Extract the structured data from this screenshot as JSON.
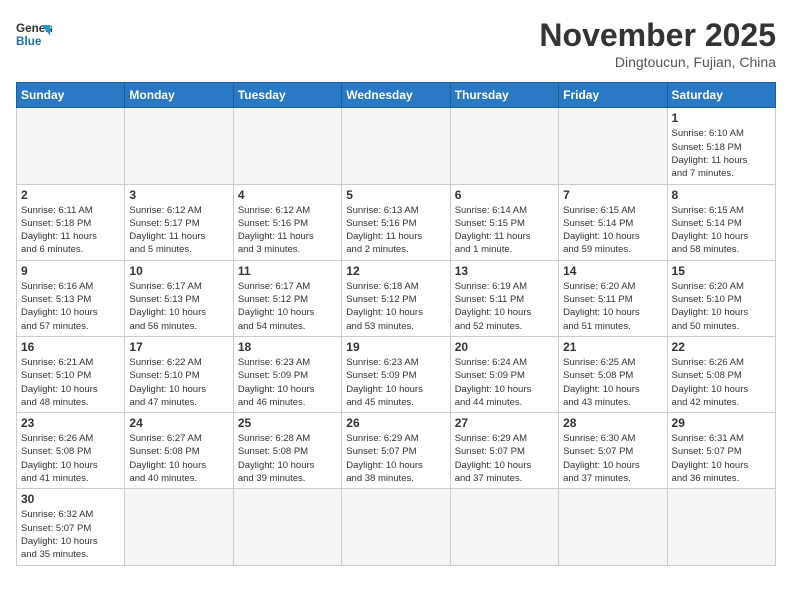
{
  "header": {
    "logo_line1": "General",
    "logo_line2": "Blue",
    "month_title": "November 2025",
    "location": "Dingtoucun, Fujian, China"
  },
  "weekdays": [
    "Sunday",
    "Monday",
    "Tuesday",
    "Wednesday",
    "Thursday",
    "Friday",
    "Saturday"
  ],
  "weeks": [
    [
      {
        "day": "",
        "empty": true
      },
      {
        "day": "",
        "empty": true
      },
      {
        "day": "",
        "empty": true
      },
      {
        "day": "",
        "empty": true
      },
      {
        "day": "",
        "empty": true
      },
      {
        "day": "",
        "empty": true
      },
      {
        "day": "1",
        "info": "Sunrise: 6:10 AM\nSunset: 5:18 PM\nDaylight: 11 hours\nand 7 minutes."
      }
    ],
    [
      {
        "day": "2",
        "info": "Sunrise: 6:11 AM\nSunset: 5:18 PM\nDaylight: 11 hours\nand 6 minutes."
      },
      {
        "day": "3",
        "info": "Sunrise: 6:12 AM\nSunset: 5:17 PM\nDaylight: 11 hours\nand 5 minutes."
      },
      {
        "day": "4",
        "info": "Sunrise: 6:12 AM\nSunset: 5:16 PM\nDaylight: 11 hours\nand 3 minutes."
      },
      {
        "day": "5",
        "info": "Sunrise: 6:13 AM\nSunset: 5:16 PM\nDaylight: 11 hours\nand 2 minutes."
      },
      {
        "day": "6",
        "info": "Sunrise: 6:14 AM\nSunset: 5:15 PM\nDaylight: 11 hours\nand 1 minute."
      },
      {
        "day": "7",
        "info": "Sunrise: 6:15 AM\nSunset: 5:14 PM\nDaylight: 10 hours\nand 59 minutes."
      },
      {
        "day": "8",
        "info": "Sunrise: 6:15 AM\nSunset: 5:14 PM\nDaylight: 10 hours\nand 58 minutes."
      }
    ],
    [
      {
        "day": "9",
        "info": "Sunrise: 6:16 AM\nSunset: 5:13 PM\nDaylight: 10 hours\nand 57 minutes."
      },
      {
        "day": "10",
        "info": "Sunrise: 6:17 AM\nSunset: 5:13 PM\nDaylight: 10 hours\nand 56 minutes."
      },
      {
        "day": "11",
        "info": "Sunrise: 6:17 AM\nSunset: 5:12 PM\nDaylight: 10 hours\nand 54 minutes."
      },
      {
        "day": "12",
        "info": "Sunrise: 6:18 AM\nSunset: 5:12 PM\nDaylight: 10 hours\nand 53 minutes."
      },
      {
        "day": "13",
        "info": "Sunrise: 6:19 AM\nSunset: 5:11 PM\nDaylight: 10 hours\nand 52 minutes."
      },
      {
        "day": "14",
        "info": "Sunrise: 6:20 AM\nSunset: 5:11 PM\nDaylight: 10 hours\nand 51 minutes."
      },
      {
        "day": "15",
        "info": "Sunrise: 6:20 AM\nSunset: 5:10 PM\nDaylight: 10 hours\nand 50 minutes."
      }
    ],
    [
      {
        "day": "16",
        "info": "Sunrise: 6:21 AM\nSunset: 5:10 PM\nDaylight: 10 hours\nand 48 minutes."
      },
      {
        "day": "17",
        "info": "Sunrise: 6:22 AM\nSunset: 5:10 PM\nDaylight: 10 hours\nand 47 minutes."
      },
      {
        "day": "18",
        "info": "Sunrise: 6:23 AM\nSunset: 5:09 PM\nDaylight: 10 hours\nand 46 minutes."
      },
      {
        "day": "19",
        "info": "Sunrise: 6:23 AM\nSunset: 5:09 PM\nDaylight: 10 hours\nand 45 minutes."
      },
      {
        "day": "20",
        "info": "Sunrise: 6:24 AM\nSunset: 5:09 PM\nDaylight: 10 hours\nand 44 minutes."
      },
      {
        "day": "21",
        "info": "Sunrise: 6:25 AM\nSunset: 5:08 PM\nDaylight: 10 hours\nand 43 minutes."
      },
      {
        "day": "22",
        "info": "Sunrise: 6:26 AM\nSunset: 5:08 PM\nDaylight: 10 hours\nand 42 minutes."
      }
    ],
    [
      {
        "day": "23",
        "info": "Sunrise: 6:26 AM\nSunset: 5:08 PM\nDaylight: 10 hours\nand 41 minutes."
      },
      {
        "day": "24",
        "info": "Sunrise: 6:27 AM\nSunset: 5:08 PM\nDaylight: 10 hours\nand 40 minutes."
      },
      {
        "day": "25",
        "info": "Sunrise: 6:28 AM\nSunset: 5:08 PM\nDaylight: 10 hours\nand 39 minutes."
      },
      {
        "day": "26",
        "info": "Sunrise: 6:29 AM\nSunset: 5:07 PM\nDaylight: 10 hours\nand 38 minutes."
      },
      {
        "day": "27",
        "info": "Sunrise: 6:29 AM\nSunset: 5:07 PM\nDaylight: 10 hours\nand 37 minutes."
      },
      {
        "day": "28",
        "info": "Sunrise: 6:30 AM\nSunset: 5:07 PM\nDaylight: 10 hours\nand 37 minutes."
      },
      {
        "day": "29",
        "info": "Sunrise: 6:31 AM\nSunset: 5:07 PM\nDaylight: 10 hours\nand 36 minutes."
      }
    ],
    [
      {
        "day": "30",
        "info": "Sunrise: 6:32 AM\nSunset: 5:07 PM\nDaylight: 10 hours\nand 35 minutes."
      },
      {
        "day": "",
        "empty": true
      },
      {
        "day": "",
        "empty": true
      },
      {
        "day": "",
        "empty": true
      },
      {
        "day": "",
        "empty": true
      },
      {
        "day": "",
        "empty": true
      },
      {
        "day": "",
        "empty": true
      }
    ]
  ]
}
